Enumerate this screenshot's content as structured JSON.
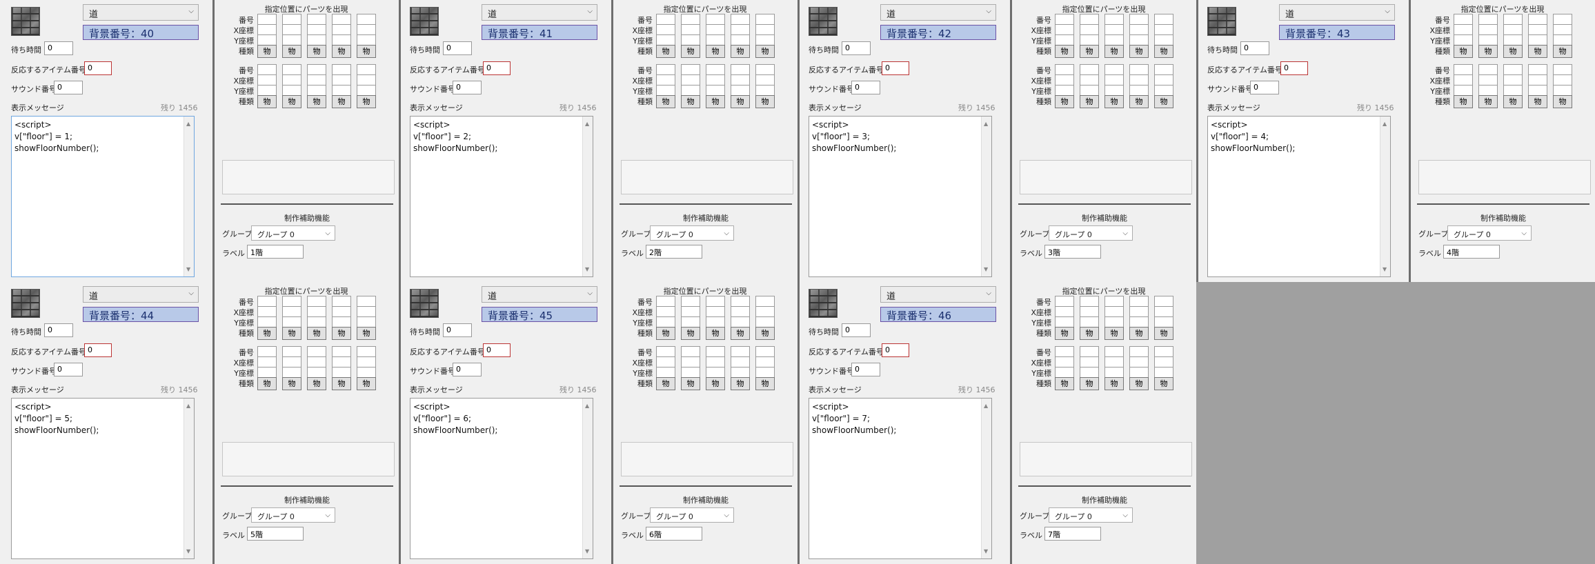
{
  "common": {
    "type_value": "道",
    "bgnum_prefix": "背景番号：",
    "wait_label": "待ち時間",
    "wait_value": "0",
    "item_label": "反応するアイテム番号",
    "item_value": "0",
    "sound_label": "サウンド番号",
    "sound_value": "0",
    "msg_label": "表示メッセージ",
    "remain_label": "残り",
    "remain_value": "1456",
    "parts_title": "指定位置にパーツを出現",
    "row_labels": [
      "番号",
      "X座標",
      "Y座標",
      "種類"
    ],
    "btn_label": "物",
    "aux_title": "制作補助機能",
    "group_label": "グループ",
    "group_value": "グループ 0",
    "label_label": "ラベル"
  },
  "panels": [
    {
      "bg_number": "背景番号：40",
      "message": "<script>\nv[\"floor\"] = 1;\nshowFloorNumber();",
      "label_value": "1階"
    },
    {
      "bg_number": "背景番号：41",
      "message": "<script>\nv[\"floor\"] = 2;\nshowFloorNumber();",
      "label_value": "2階"
    },
    {
      "bg_number": "背景番号：42",
      "message": "<script>\nv[\"floor\"] = 3;\nshowFloorNumber();",
      "label_value": "3階"
    },
    {
      "bg_number": "背景番号：43",
      "message": "<script>\nv[\"floor\"] = 4;\nshowFloorNumber();",
      "label_value": "4階"
    },
    {
      "bg_number": "背景番号：44",
      "message": "<script>\nv[\"floor\"] = 5;\nshowFloorNumber();",
      "label_value": "5階"
    },
    {
      "bg_number": "背景番号：45",
      "message": "<script>\nv[\"floor\"] = 6;\nshowFloorNumber();",
      "label_value": "6階"
    },
    {
      "bg_number": "背景番号：46",
      "message": "<script>\nv[\"floor\"] = 7;\nshowFloorNumber();",
      "label_value": "7階"
    }
  ],
  "colors": {
    "panel_bg": "#f0f0f0",
    "empty_area": "#a0a0a0",
    "bgnum_fill": "#b8c9e8",
    "bgnum_border": "#6a52a6"
  }
}
